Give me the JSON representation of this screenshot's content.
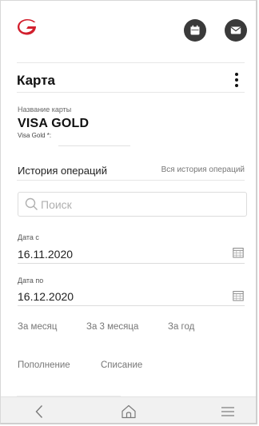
{
  "app": {
    "logo_icon": "bank-logo-icon",
    "brand_color": "#d21f2d",
    "icon_dark": "#3a3a3a"
  },
  "header": {
    "calendar_icon": "calendar-icon",
    "mail_icon": "mail-icon",
    "title": "Карта",
    "menu_icon": "kebab-menu-icon"
  },
  "card": {
    "label": "Название карты",
    "name": "VISA GOLD",
    "sub": "Visa Gold *:"
  },
  "history": {
    "title": "История операций",
    "all_link": "Вся история операций"
  },
  "search": {
    "placeholder": "Поиск",
    "value": ""
  },
  "date_from": {
    "label": "Дата с",
    "value": "16.11.2020"
  },
  "date_to": {
    "label": "Дата по",
    "value": "16.12.2020"
  },
  "periods": [
    "За месяц",
    "За 3 месяца",
    "За год"
  ],
  "types": [
    "Пополнение",
    "Списание"
  ],
  "nav": {
    "back_icon": "back-chevron-icon",
    "home_icon": "home-icon",
    "menu_icon": "hamburger-menu-icon"
  }
}
